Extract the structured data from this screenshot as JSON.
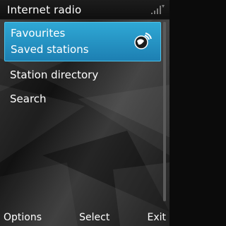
{
  "header": {
    "title": "Internet radio",
    "signal_icon": "signal-bars-icon"
  },
  "menu": {
    "items": [
      {
        "label": "Favourites",
        "sublabel": "Saved stations",
        "icon": "globe-radio-icon",
        "selected": true
      },
      {
        "label": "Station directory"
      },
      {
        "label": "Search"
      }
    ]
  },
  "softkeys": {
    "left": "Options",
    "center": "Select",
    "right": "Exit"
  },
  "colors": {
    "highlight": "#2fa8d5",
    "background": "#111111",
    "text": "#ffffff"
  }
}
